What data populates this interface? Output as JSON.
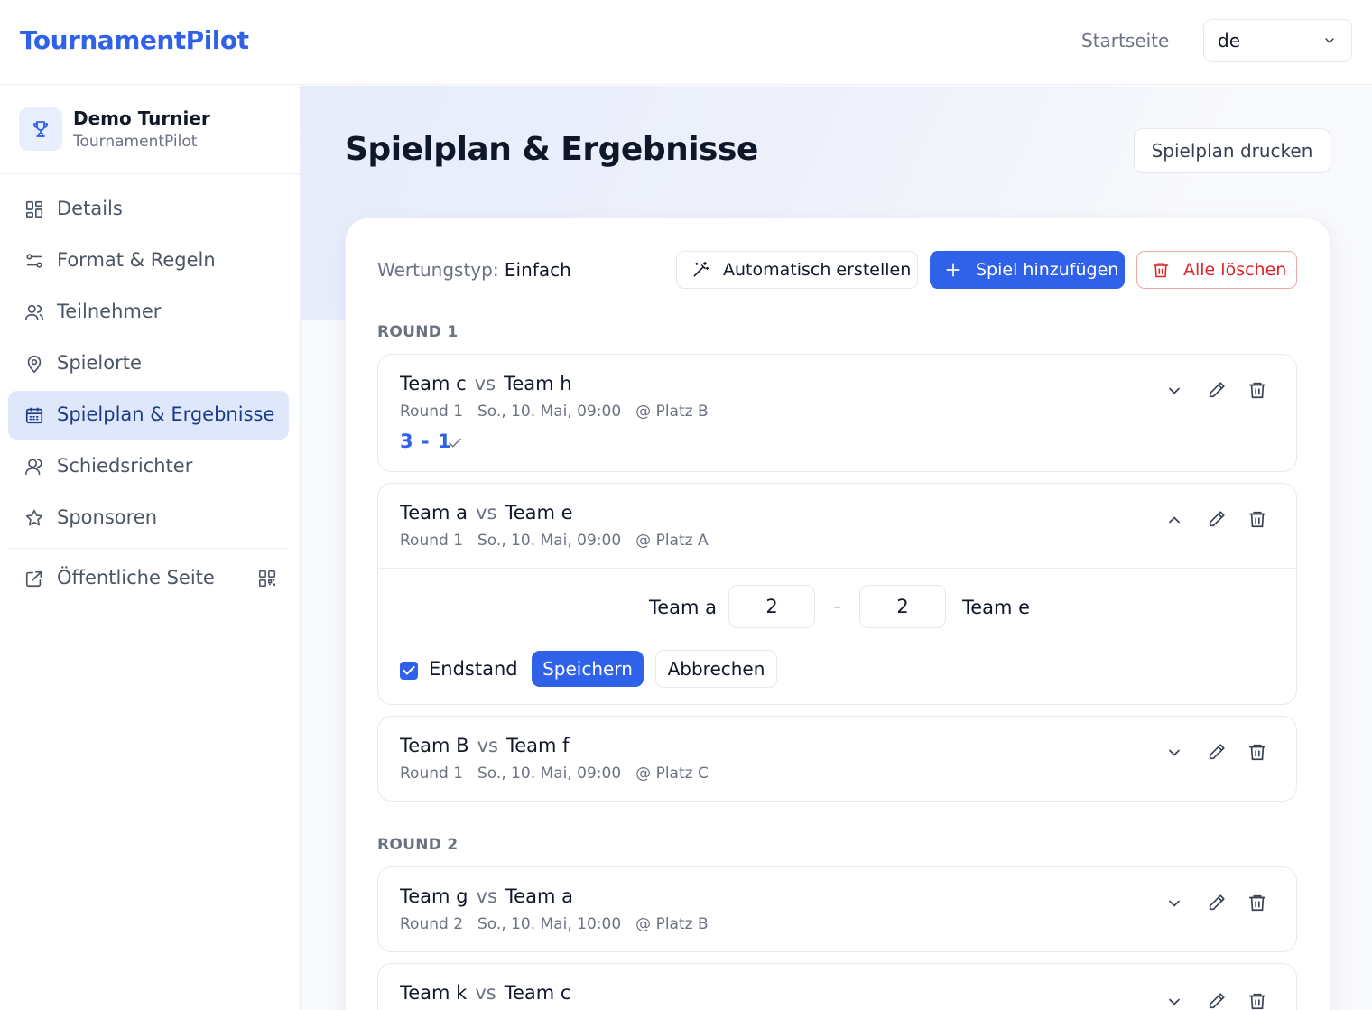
{
  "header": {
    "brand": "TournamentPilot",
    "nav_home": "Startseite",
    "language": "de"
  },
  "sidebar": {
    "tournament_name": "Demo Turnier",
    "tournament_sub": "TournamentPilot",
    "items": [
      {
        "label": "Details",
        "icon": "grid-icon"
      },
      {
        "label": "Format & Regeln",
        "icon": "sliders-icon"
      },
      {
        "label": "Teilnehmer",
        "icon": "users-icon"
      },
      {
        "label": "Spielorte",
        "icon": "map-pin-icon"
      },
      {
        "label": "Spielplan & Ergebnisse",
        "icon": "calendar-icon",
        "active": true
      },
      {
        "label": "Schiedsrichter",
        "icon": "user-icon"
      },
      {
        "label": "Sponsoren",
        "icon": "star-icon"
      }
    ],
    "public_page": "Öffentliche Seite"
  },
  "main": {
    "title": "Spielplan & Ergebnisse",
    "print_label": "Spielplan drucken",
    "scoring_label": "Wertungstyp:",
    "scoring_value": "Einfach",
    "auto_create_label": "Automatisch erstellen",
    "add_match_label": "Spiel hinzufügen",
    "delete_all_label": "Alle löschen",
    "vs": "vs",
    "rounds": [
      {
        "label": "ROUND 1",
        "matches": [
          {
            "home": "Team c",
            "away": "Team h",
            "round": "Round 1",
            "date": "So., 10. Mai, 09:00",
            "venue": "@ Platz B",
            "score": "3 - 1"
          },
          {
            "home": "Team a",
            "away": "Team e",
            "round": "Round 1",
            "date": "So., 10. Mai, 09:00",
            "venue": "@ Platz A"
          },
          {
            "home": "Team B",
            "away": "Team f",
            "round": "Round 1",
            "date": "So., 10. Mai, 09:00",
            "venue": "@ Platz C"
          }
        ]
      },
      {
        "label": "ROUND 2",
        "matches": [
          {
            "home": "Team g",
            "away": "Team a",
            "round": "Round 2",
            "date": "So., 10. Mai, 10:00",
            "venue": "@ Platz B"
          },
          {
            "home": "Team k",
            "away": "Team c"
          }
        ]
      }
    ],
    "editor": {
      "home": "Team a",
      "away": "Team e",
      "home_score": "2",
      "away_score": "2",
      "separator": "–",
      "final_label": "Endstand",
      "final_checked": true,
      "save_label": "Speichern",
      "cancel_label": "Abbrechen"
    }
  },
  "colors": {
    "accent": "#2f62e8",
    "danger": "#dc2626",
    "active_bg": "#dfe8fb"
  }
}
